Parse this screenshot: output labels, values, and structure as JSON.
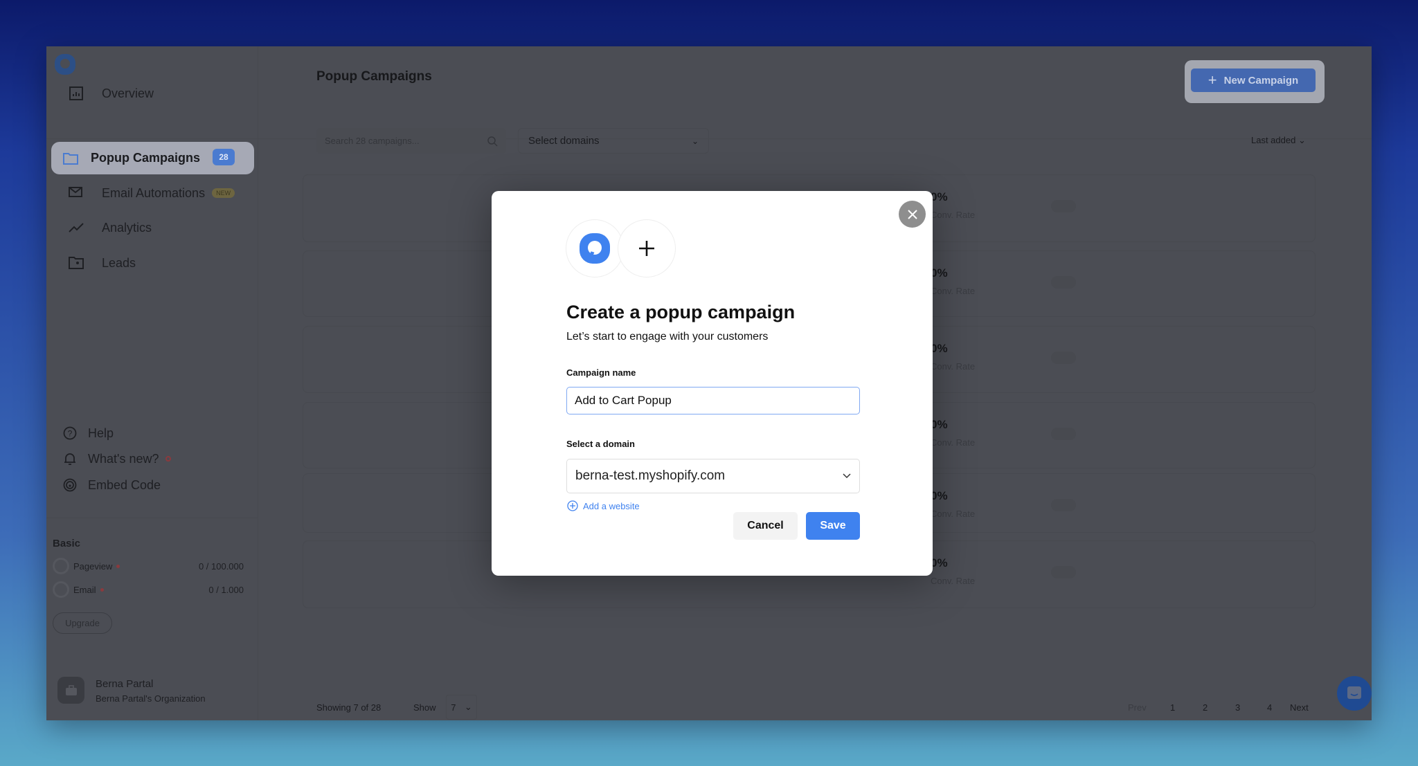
{
  "sidebar": {
    "nav": [
      {
        "label": "Overview",
        "icon": "chart-icon"
      },
      {
        "label": "Popup Campaigns",
        "icon": "folder-icon",
        "badge": "28"
      },
      {
        "label": "Email Automations",
        "icon": "mail-icon",
        "tag": "NEW"
      },
      {
        "label": "Analytics",
        "icon": "trend-icon"
      },
      {
        "label": "Leads",
        "icon": "contact-folder-icon"
      }
    ],
    "bottom": [
      {
        "label": "Help",
        "icon": "help-icon"
      },
      {
        "label": "What's new?",
        "icon": "bell-icon"
      },
      {
        "label": "Embed Code",
        "icon": "broadcast-icon"
      }
    ],
    "plan": {
      "title": "Basic",
      "usage": [
        {
          "label": "Pageview",
          "value": "0 / 100.000"
        },
        {
          "label": "Email",
          "value": "0 / 1.000"
        }
      ],
      "upgrade": "Upgrade"
    },
    "user": {
      "name": "Berna Partal",
      "org": "Berna Partal's Organization"
    }
  },
  "header": {
    "title": "Popup Campaigns",
    "new_campaign": "New Campaign"
  },
  "filters": {
    "search_placeholder": "Search 28 campaigns...",
    "domains": "Select domains",
    "sort": "Last added"
  },
  "rows": [
    {
      "value": "0%",
      "label": "Conv. Rate"
    },
    {
      "value": "0%",
      "label": "Conv. Rate"
    },
    {
      "value": "0%",
      "label": "Conv. Rate"
    },
    {
      "value": "0%",
      "label": "Conv. Rate"
    },
    {
      "value": "0%",
      "label": "Conv. Rate"
    },
    {
      "value": "0%",
      "label": "Conv. Rate"
    }
  ],
  "footer": {
    "showing": "Showing 7 of 28",
    "show": "Show",
    "per_page": "7",
    "prev": "Prev",
    "pages": [
      "1",
      "2",
      "3",
      "4"
    ],
    "next": "Next"
  },
  "modal": {
    "title": "Create a popup campaign",
    "subtitle": "Let’s start to engage with your customers",
    "name_label": "Campaign name",
    "name_value": "Add to Cart Popup",
    "domain_label": "Select a domain",
    "domain_value": "berna-test.myshopify.com",
    "add_website": "Add a website",
    "cancel": "Cancel",
    "save": "Save"
  },
  "colors": {
    "accent": "#3f82ef",
    "overlay": "#4b4d54"
  }
}
